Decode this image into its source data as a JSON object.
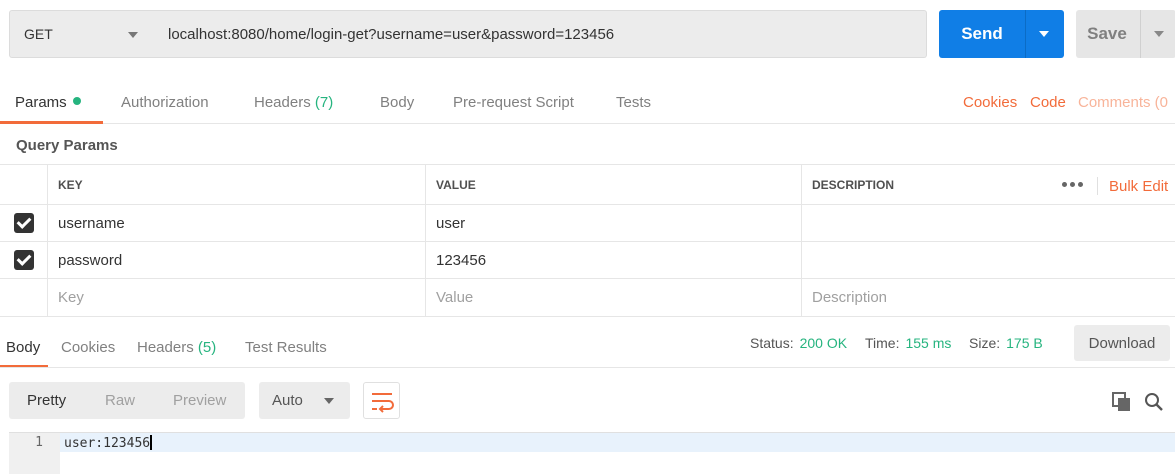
{
  "request": {
    "method": "GET",
    "url": "localhost:8080/home/login-get?username=user&password=123456",
    "send_label": "Send",
    "save_label": "Save"
  },
  "request_tabs": {
    "params": "Params",
    "authorization": "Authorization",
    "headers": "Headers",
    "headers_count": "(7)",
    "body": "Body",
    "prerequest": "Pre-request Script",
    "tests": "Tests"
  },
  "right_links": {
    "cookies": "Cookies",
    "code": "Code",
    "comments": "Comments (0"
  },
  "query_params": {
    "title": "Query Params",
    "columns": {
      "key": "KEY",
      "value": "VALUE",
      "description": "DESCRIPTION"
    },
    "bulk_edit": "Bulk Edit",
    "rows": [
      {
        "checked": true,
        "key": "username",
        "value": "user",
        "description": ""
      },
      {
        "checked": true,
        "key": "password",
        "value": "123456",
        "description": ""
      }
    ],
    "placeholder": {
      "key": "Key",
      "value": "Value",
      "description": "Description"
    }
  },
  "response_tabs": {
    "body": "Body",
    "cookies": "Cookies",
    "headers": "Headers",
    "headers_count": "(5)",
    "test_results": "Test Results"
  },
  "response_status": {
    "status_label": "Status:",
    "status_value": "200 OK",
    "time_label": "Time:",
    "time_value": "155 ms",
    "size_label": "Size:",
    "size_value": "175 B",
    "download_label": "Download"
  },
  "body_view": {
    "modes": [
      "Pretty",
      "Raw",
      "Preview"
    ],
    "active_mode": "Pretty",
    "format": "Auto"
  },
  "editor": {
    "line_number": "1",
    "content": "user:123456"
  },
  "colors": {
    "accent": "#f26b3a",
    "primary_button": "#107ee6",
    "success": "#26b47f"
  }
}
